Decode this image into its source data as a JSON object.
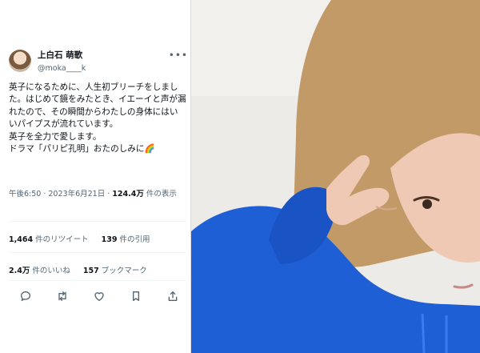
{
  "tweet": {
    "display_name": "上白石 萌歌",
    "handle": "@moka____k",
    "more_label": "•••",
    "text": "英子になるために、人生初ブリーチをしました。はじめて鏡をみたとき、イエーイと声が漏れたので、その瞬間からわたしの身体にはいいパイプスが流れています。\n英子を全力で愛します。\nドラマ「パリピ孔明」おたのしみに🌈",
    "timestamp": "午後6:50 · 2023年6月21日 · ",
    "views_count": "124.4万",
    "views_label": " 件の表示",
    "retweets_count": "1,464",
    "retweets_label": " 件のリツイート",
    "quotes_count": "139",
    "quotes_label": " 件の引用",
    "likes_count": "2.4万",
    "likes_label": " 件のいいね",
    "bookmarks_count": "157",
    "bookmarks_label": " ブックマーク"
  },
  "actions": {
    "icons": [
      "reply-icon",
      "retweet-icon",
      "like-icon",
      "bookmark-icon",
      "share-icon"
    ],
    "icon_color": "#536471"
  },
  "photo": {
    "hoodie_color": "#1f5fd6",
    "hair_color": "#c19a68",
    "wall_color": "#ecebe8"
  }
}
